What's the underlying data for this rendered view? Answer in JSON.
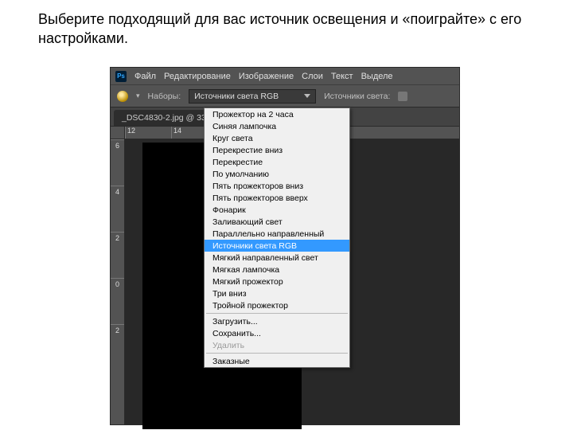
{
  "instruction": "Выберите подходящий для вас источник освещения и «поиграйте» с его настройками.",
  "menubar": {
    "items": [
      "Файл",
      "Редактирование",
      "Изображение",
      "Слои",
      "Текст",
      "Выделе"
    ]
  },
  "toolbar": {
    "nabory_label": "Наборы:",
    "preset_value": "Источники света RGB",
    "sources_label": "Источники света:"
  },
  "doctab": "_DSC4830-2.jpg @ 33",
  "ruler_h": [
    "12",
    "14"
  ],
  "ruler_v": [
    "6",
    "4",
    "2",
    "0",
    "2"
  ],
  "dropdown": {
    "group1": [
      "Прожектор на 2 часа",
      "Синяя лампочка",
      "Круг света",
      "Перекрестие вниз",
      "Перекрестие",
      "По умолчанию",
      "Пять прожекторов вниз",
      "Пять прожекторов вверх",
      "Фонарик",
      "Заливающий свет",
      "Параллельно направленный",
      "Источники света RGB",
      "Мягкий направленный свет",
      "Мягкая лампочка",
      "Мягкий прожектор",
      "Три вниз",
      "Тройной прожектор"
    ],
    "group2": [
      "Загрузить...",
      "Сохранить..."
    ],
    "group2_disabled": "Удалить",
    "group3": [
      "Заказные"
    ],
    "selected": "Источники света RGB"
  }
}
